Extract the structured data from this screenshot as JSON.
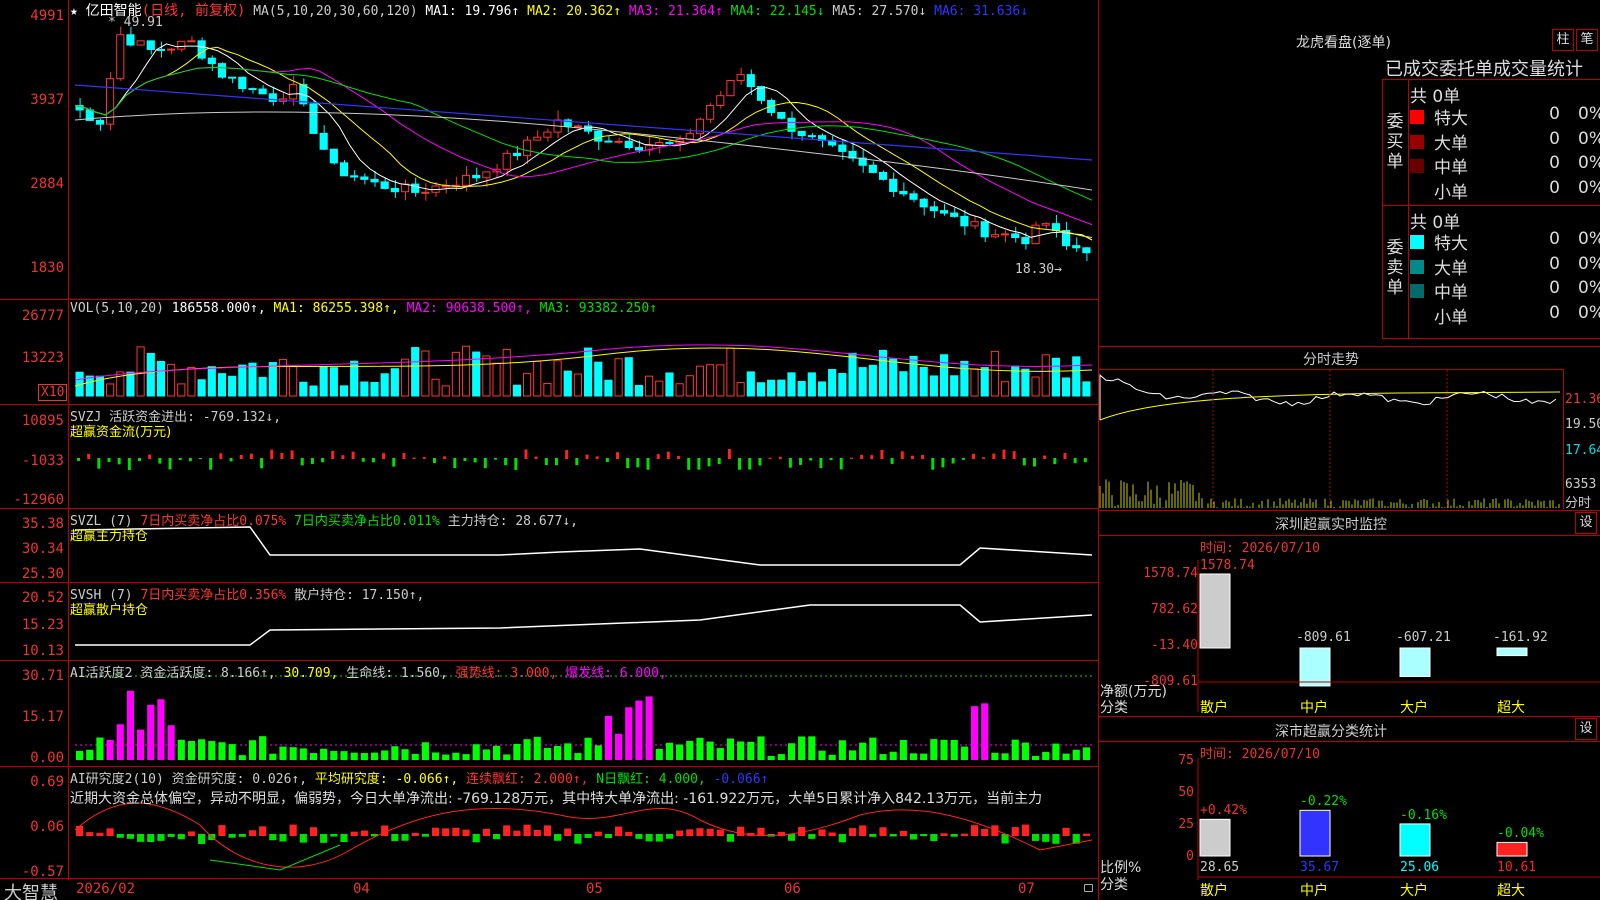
{
  "main": {
    "stock_name": "亿田智能",
    "period": "(日线, 前复权)",
    "ma_legend": [
      {
        "text": "MA(5,10,20,30,60,120)",
        "color": "#cccccc"
      },
      {
        "text": "MA1: 19.796↑",
        "color": "#ffffff"
      },
      {
        "text": "MA2: 20.362↑",
        "color": "#ffff00"
      },
      {
        "text": "MA3: 21.364↑",
        "color": "#ff00ff"
      },
      {
        "text": "MA4: 22.145↓",
        "color": "#00e000"
      },
      {
        "text": "MA5: 27.570↓",
        "color": "#cccccc"
      },
      {
        "text": "MA6: 31.636↓",
        "color": "#3333ff"
      }
    ],
    "y_ticks": [
      "49.91",
      "39.37",
      "28.84",
      "18.30"
    ],
    "y_labels_display": [
      "4991",
      "3937",
      "2884",
      "1830"
    ],
    "high_mark": "49.91",
    "low_mark": "18.30"
  },
  "vol": {
    "legend": [
      {
        "text": "VOL(5,10,20)",
        "color": "#cccccc"
      },
      {
        "text": "186558.000↑,",
        "color": "#ffffff"
      },
      {
        "text": "MA1: 86255.398↑,",
        "color": "#ffff00"
      },
      {
        "text": "MA2: 90638.500↑,",
        "color": "#ff00ff"
      },
      {
        "text": "MA3: 93382.250↑",
        "color": "#00e000"
      }
    ],
    "y_ticks": [
      "26777",
      "13223"
    ],
    "unit": "X10"
  },
  "svzj": {
    "legend": [
      {
        "text": "SVZJ  活跃资金进出: -769.132↓,",
        "color": "#cccccc"
      }
    ],
    "subtitle": "超赢资金流(万元)",
    "y_ticks": [
      "10895",
      "-1033",
      "-12960"
    ]
  },
  "svzl": {
    "legend": [
      {
        "text": "SVZL (7)",
        "color": "#cccccc"
      },
      {
        "text": "7日内买卖净占比0.075%",
        "color": "#ff3333"
      },
      {
        "text": "7日内买卖净占比0.011%",
        "color": "#00e000"
      },
      {
        "text": "主力持仓: 28.677↓,",
        "color": "#cccccc"
      }
    ],
    "subtitle": "超赢主力持仓",
    "y_ticks": [
      "35.38",
      "30.34",
      "25.30"
    ]
  },
  "svsh": {
    "legend": [
      {
        "text": "SVSH (7)",
        "color": "#cccccc"
      },
      {
        "text": "7日内买卖净占比0.356%",
        "color": "#ff3333"
      },
      {
        "text": "散户持仓: 17.150↑,",
        "color": "#cccccc"
      }
    ],
    "subtitle": "超赢散户持仓",
    "y_ticks": [
      "20.52",
      "15.23",
      "10.13"
    ]
  },
  "ai_active": {
    "legend": [
      {
        "text": "AI活跃度2",
        "color": "#cccccc"
      },
      {
        "text": "资金活跃度: 8.166↑,",
        "color": "#cccccc"
      },
      {
        "text": "30.709,",
        "color": "#ffff00"
      },
      {
        "text": "生命线: 1.560,",
        "color": "#cccccc"
      },
      {
        "text": "强势线: 3.000,",
        "color": "#ff3333"
      },
      {
        "text": "爆发线: 6.000,",
        "color": "#ff00ff"
      }
    ],
    "y_ticks": [
      "30.71",
      "15.17",
      "0.00"
    ]
  },
  "ai_research": {
    "legend": [
      {
        "text": "AI研究度2(10)",
        "color": "#cccccc"
      },
      {
        "text": "资金研究度: 0.026↑,",
        "color": "#cccccc"
      },
      {
        "text": "平均研究度: -0.066↑,",
        "color": "#ffff00"
      },
      {
        "text": "连续飘红: 2.000↑,",
        "color": "#ff3333"
      },
      {
        "text": "N日飘红: 4.000,",
        "color": "#00e000"
      },
      {
        "text": "-0.066↑",
        "color": "#3333ff"
      }
    ],
    "comment": "近期大资金总体偏空，异动不明显，偏弱势，今日大单净流出: -769.128万元，其中特大单净流出: -161.922万元，大单5日累计净入842.13万元，当前主力",
    "y_ticks": [
      "0.69",
      "0.06",
      "-0.57"
    ]
  },
  "bottom": {
    "brand": "大智慧",
    "dates": [
      "2026/02",
      "04",
      "05",
      "06",
      "07"
    ]
  },
  "right": {
    "lhb_title": "龙虎看盘(逐单)",
    "btn_bar": "柱",
    "btn_pen": "笔",
    "tabs_header": "已成交委托单成交量统计",
    "buy_group": {
      "label": "委买单",
      "count": "共 0单",
      "rows": [
        {
          "label": "特大",
          "n": "0",
          "p": "0%",
          "color": "#ff0000"
        },
        {
          "label": "大单",
          "n": "0",
          "p": "0%",
          "color": "#990000"
        },
        {
          "label": "中单",
          "n": "0",
          "p": "0%",
          "color": "#660000"
        },
        {
          "label": "小单",
          "n": "0",
          "p": "0%",
          "color": "#000000"
        }
      ]
    },
    "sell_group": {
      "label": "委卖单",
      "count": "共 0单",
      "rows": [
        {
          "label": "特大",
          "n": "0",
          "p": "0%",
          "color": "#00ffff"
        },
        {
          "label": "大单",
          "n": "0",
          "p": "0%",
          "color": "#008b8b"
        },
        {
          "label": "中单",
          "n": "0",
          "p": "0%",
          "color": "#006b6b"
        },
        {
          "label": "小单",
          "n": "0",
          "p": "0%",
          "color": "#000000"
        }
      ]
    },
    "intraday": {
      "title": "分时走势",
      "ticks": [
        "21.36",
        "19.50",
        "17.64",
        "6353"
      ],
      "unit": "分时"
    },
    "monitor": {
      "title": "深圳超赢实时监控",
      "btn": "设",
      "time": "时间: 2026/07/10",
      "y_ticks": [
        "1578.74",
        "782.62",
        "-13.40",
        "-809.61"
      ],
      "axis_label_1": "净额(万元)",
      "axis_label_2": "分类",
      "bars": [
        {
          "cat": "散户",
          "value": 1578.74,
          "label": "1578.74"
        },
        {
          "cat": "中户",
          "value": -809.61,
          "label": "-809.61"
        },
        {
          "cat": "大户",
          "value": -607.21,
          "label": "-607.21"
        },
        {
          "cat": "超大",
          "value": -161.92,
          "label": "-161.92"
        }
      ]
    },
    "classify": {
      "title": "深市超赢分类统计",
      "btn": "设",
      "time": "时间: 2026/07/10",
      "y_ticks": [
        "75",
        "50",
        "25",
        "0"
      ],
      "axis_label_1": "比例%",
      "axis_label_2": "分类",
      "bars": [
        {
          "cat": "散户",
          "value": 28.65,
          "label": "28.65",
          "change": "+0.42%"
        },
        {
          "cat": "中户",
          "value": 35.67,
          "label": "35.67",
          "change": "-0.22%"
        },
        {
          "cat": "大户",
          "value": 25.06,
          "label": "25.06",
          "change": "-0.16%"
        },
        {
          "cat": "超大",
          "value": 10.61,
          "label": "10.61",
          "change": "-0.04%"
        }
      ]
    }
  }
}
